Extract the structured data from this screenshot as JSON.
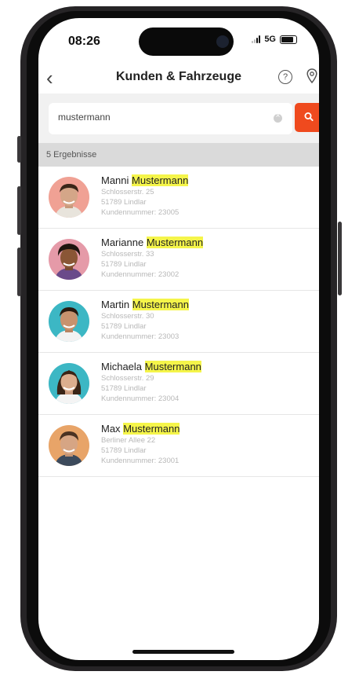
{
  "status": {
    "time": "08:26",
    "network": "5G"
  },
  "nav": {
    "title": "Kunden & Fahrzeuge",
    "back_icon": "chevron-left-icon",
    "help_icon": "question-circle-icon",
    "location_icon": "location-pin-icon"
  },
  "search": {
    "value": "mustermann",
    "button_color": "#ef4a1e",
    "button_icon": "search-icon"
  },
  "results": {
    "count_label": "5 Ergebnisse",
    "items": [
      {
        "first": "Manni",
        "last": "Mustermann",
        "street": "Schlosserstr. 25",
        "city": "51789 Lindlar",
        "customer": "Kundennummer: 23005"
      },
      {
        "first": "Marianne",
        "last": "Mustermann",
        "street": "Schlosserstr. 33",
        "city": "51789 Lindlar",
        "customer": "Kundennummer: 23002"
      },
      {
        "first": "Martin",
        "last": "Mustermann",
        "street": "Schlosserstr. 30",
        "city": "51789 Lindlar",
        "customer": "Kundennummer: 23003"
      },
      {
        "first": "Michaela",
        "last": "Mustermann",
        "street": "Schlosserstr. 29",
        "city": "51789 Lindlar",
        "customer": "Kundennummer: 23004"
      },
      {
        "first": "Max",
        "last": "Mustermann",
        "street": "Berliner Allee 22",
        "city": "51789 Lindlar",
        "customer": "Kundennummer: 23001"
      }
    ]
  },
  "colors": {
    "highlight": "#f5f54a",
    "accent": "#ef4a1e"
  }
}
